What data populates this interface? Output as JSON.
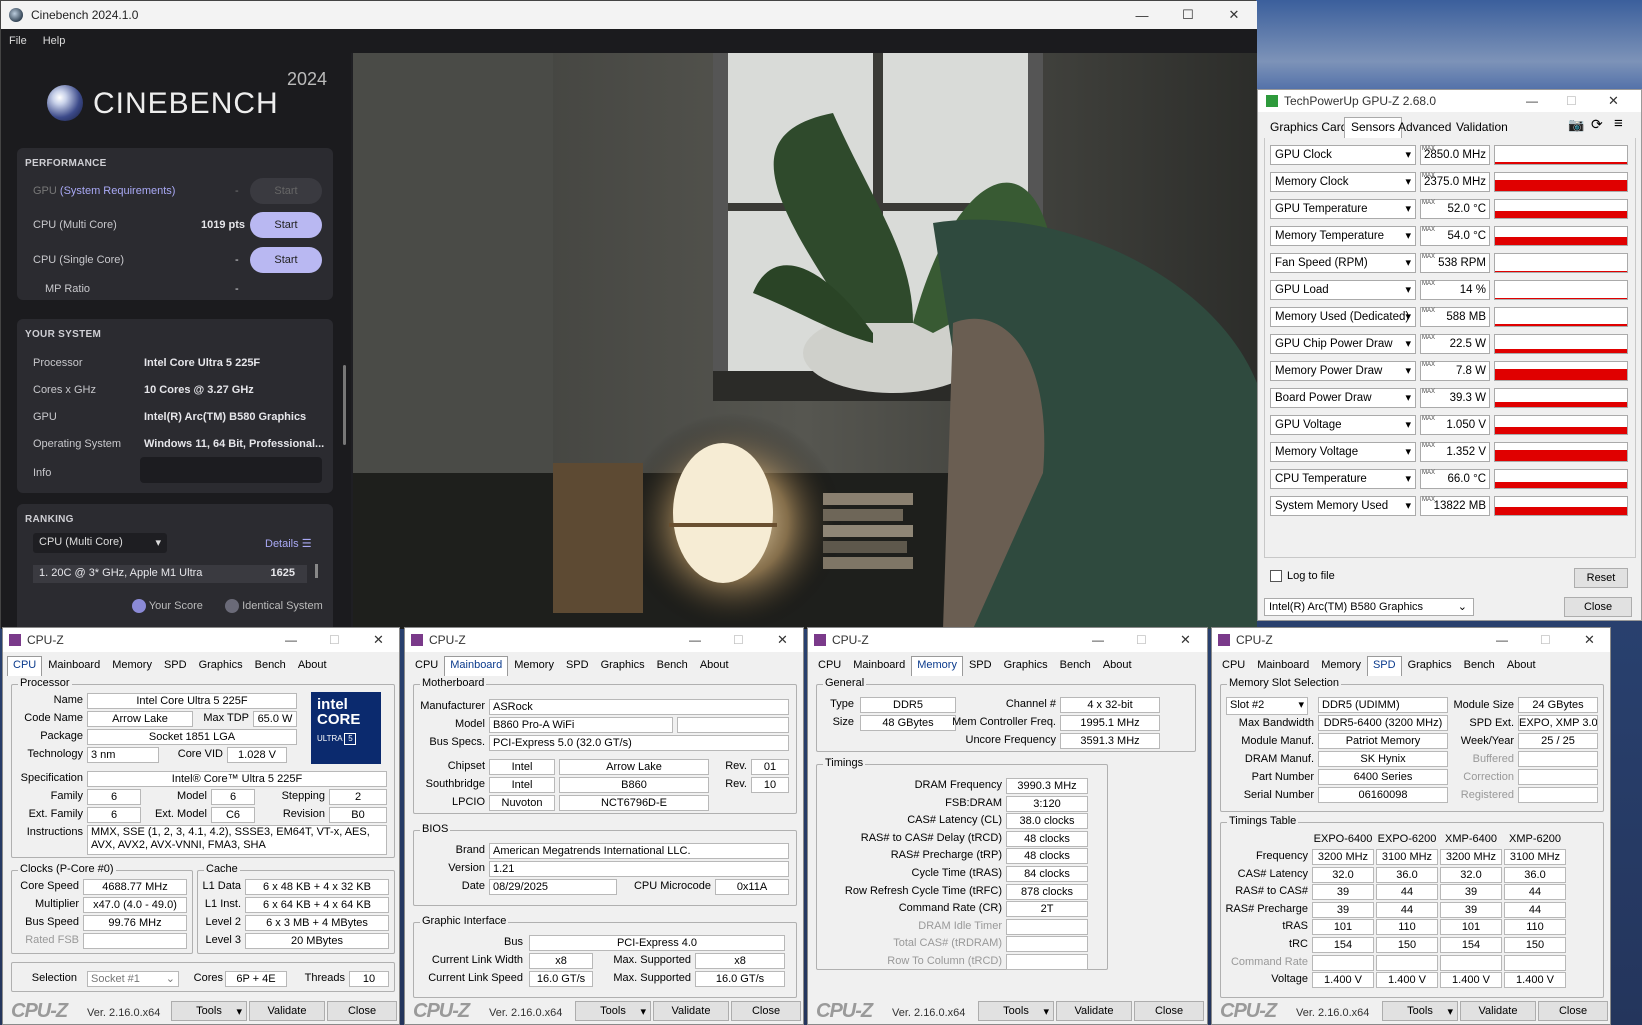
{
  "cinebench": {
    "title": "Cinebench 2024.1.0",
    "menu": [
      "File",
      "Help"
    ],
    "logo": "CINEBENCH",
    "logo_year": "2024",
    "performance": {
      "header": "PERFORMANCE",
      "gpu_label": "GPU",
      "gpu_link": "(System Requirements)",
      "gpu_value": "-",
      "multi_label": "CPU (Multi Core)",
      "multi_value": "1019 pts",
      "single_label": "CPU (Single Core)",
      "single_value": "-",
      "mp_label": "MP Ratio",
      "mp_value": "-",
      "start": "Start"
    },
    "system": {
      "header": "YOUR SYSTEM",
      "rows": [
        {
          "label": "Processor",
          "value": "Intel Core Ultra 5 225F"
        },
        {
          "label": "Cores x GHz",
          "value": "10 Cores @ 3.27 GHz"
        },
        {
          "label": "GPU",
          "value": "Intel(R) Arc(TM) B580 Graphics"
        },
        {
          "label": "Operating System",
          "value": "Windows 11, 64 Bit, Professional..."
        }
      ],
      "info_label": "Info"
    },
    "ranking": {
      "header": "RANKING",
      "dropdown": "CPU (Multi Core)",
      "details": "Details",
      "entry": "1. 20C @ 3* GHz, Apple M1 Ultra",
      "entry_score": "1625",
      "legend_your": "Your Score",
      "legend_identical": "Identical System"
    }
  },
  "gpuz": {
    "title": "TechPowerUp GPU-Z 2.68.0",
    "tabs": [
      "Graphics Card",
      "Sensors",
      "Advanced",
      "Validation"
    ],
    "max_tag": "MAX",
    "sensors": [
      {
        "name": "GPU Clock",
        "value": "2850.0 MHz",
        "level": 0.1
      },
      {
        "name": "Memory Clock",
        "value": "2375.0 MHz",
        "level": 0.6
      },
      {
        "name": "GPU Temperature",
        "value": "52.0 °C",
        "level": 0.4
      },
      {
        "name": "Memory Temperature",
        "value": "54.0 °C",
        "level": 0.45
      },
      {
        "name": "Fan Speed (RPM)",
        "value": "538 RPM",
        "level": 0.05
      },
      {
        "name": "GPU Load",
        "value": "14 %",
        "level": 0.05
      },
      {
        "name": "Memory Used (Dedicated)",
        "value": "588 MB",
        "level": 0.1
      },
      {
        "name": "GPU Chip Power Draw",
        "value": "22.5 W",
        "level": 0.2
      },
      {
        "name": "Memory Power Draw",
        "value": "7.8 W",
        "level": 0.6
      },
      {
        "name": "Board Power Draw",
        "value": "39.3 W",
        "level": 0.25
      },
      {
        "name": "GPU Voltage",
        "value": "1.050 V",
        "level": 0.4
      },
      {
        "name": "Memory Voltage",
        "value": "1.352 V",
        "level": 0.6
      },
      {
        "name": "CPU Temperature",
        "value": "66.0 °C",
        "level": 0.35
      },
      {
        "name": "System Memory Used",
        "value": "13822 MB",
        "level": 0.45
      }
    ],
    "log_label": "Log to file",
    "reset": "Reset",
    "device": "Intel(R) Arc(TM) B580 Graphics",
    "close": "Close"
  },
  "cpuz_common": {
    "title": "CPU-Z",
    "tabs": [
      "CPU",
      "Mainboard",
      "Memory",
      "SPD",
      "Graphics",
      "Bench",
      "About"
    ],
    "logo": "CPU-Z",
    "version": "Ver. 2.16.0.x64",
    "tools": "Tools",
    "validate": "Validate",
    "close": "Close"
  },
  "cpuz_cpu": {
    "processor_label": "Processor",
    "name_l": "Name",
    "name": "Intel Core Ultra 5 225F",
    "codename_l": "Code Name",
    "codename": "Arrow Lake",
    "maxtdp_l": "Max TDP",
    "maxtdp": "65.0 W",
    "package_l": "Package",
    "package": "Socket 1851 LGA",
    "tech_l": "Technology",
    "tech": "3 nm",
    "vid_l": "Core VID",
    "vid": "1.028 V",
    "spec_l": "Specification",
    "spec": "Intel® Core™ Ultra 5 225F",
    "family_l": "Family",
    "family": "6",
    "model_l": "Model",
    "model": "6",
    "stepping_l": "Stepping",
    "stepping": "2",
    "extfamily_l": "Ext. Family",
    "extfamily": "6",
    "extmodel_l": "Ext. Model",
    "extmodel": "C6",
    "revision_l": "Revision",
    "revision": "B0",
    "instr_l": "Instructions",
    "instr": "MMX, SSE (1, 2, 3, 4.1, 4.2), SSSE3, EM64T, VT-x, AES, AVX, AVX2, AVX-VNNI, FMA3, SHA",
    "clocks_label": "Clocks (P-Core #0)",
    "corespeed_l": "Core Speed",
    "corespeed": "4688.77 MHz",
    "mult_l": "Multiplier",
    "mult": "x47.0 (4.0 - 49.0)",
    "bus_l": "Bus Speed",
    "bus": "99.76 MHz",
    "fsb_l": "Rated FSB",
    "cache_label": "Cache",
    "l1d_l": "L1 Data",
    "l1d": "6 x 48 KB + 4 x 32 KB",
    "l1i_l": "L1 Inst.",
    "l1i": "6 x 64 KB + 4 x 64 KB",
    "l2_l": "Level 2",
    "l2": "6 x 3 MB + 4 MBytes",
    "l3_l": "Level 3",
    "l3": "20 MBytes",
    "sel_l": "Selection",
    "sel": "Socket #1",
    "cores_l": "Cores",
    "cores": "6P + 4E",
    "threads_l": "Threads",
    "threads": "10",
    "badge_line1": "intel",
    "badge_line2": "CORE",
    "badge_line3": "ULTRA",
    "badge_num": "5"
  },
  "cpuz_mb": {
    "mb_label": "Motherboard",
    "manuf_l": "Manufacturer",
    "manuf": "ASRock",
    "model_l": "Model",
    "model": "B860 Pro-A WiFi",
    "busspec_l": "Bus Specs.",
    "busspec": "PCI-Express 5.0 (32.0 GT/s)",
    "chipset_l": "Chipset",
    "chipset1": "Intel",
    "chipset2": "Arrow Lake",
    "rev_l": "Rev.",
    "chipset_rev": "01",
    "south_l": "Southbridge",
    "south1": "Intel",
    "south2": "B860",
    "south_rev": "10",
    "lpcio_l": "LPCIO",
    "lpcio1": "Nuvoton",
    "lpcio2": "NCT6796D-E",
    "bios_label": "BIOS",
    "brand_l": "Brand",
    "brand": "American Megatrends International LLC.",
    "version_l": "Version",
    "version": "1.21",
    "date_l": "Date",
    "date": "08/29/2025",
    "micro_l": "CPU Microcode",
    "micro": "0x11A",
    "gi_label": "Graphic Interface",
    "gbus_l": "Bus",
    "gbus": "PCI-Express 4.0",
    "clw_l": "Current Link Width",
    "clw": "x8",
    "msw_l": "Max. Supported",
    "msw": "x8",
    "cls_l": "Current Link Speed",
    "cls": "16.0 GT/s",
    "mss_l": "Max. Supported",
    "mss": "16.0 GT/s"
  },
  "cpuz_mem": {
    "general_label": "General",
    "type_l": "Type",
    "type": "DDR5",
    "size_l": "Size",
    "size": "48 GBytes",
    "channel_l": "Channel #",
    "channel": "4 x 32-bit",
    "mcf_l": "Mem Controller Freq.",
    "mcf": "1995.1 MHz",
    "uncore_l": "Uncore Frequency",
    "uncore": "3591.3 MHz",
    "timings_label": "Timings",
    "rows": [
      {
        "label": "DRAM Frequency",
        "value": "3990.3 MHz"
      },
      {
        "label": "FSB:DRAM",
        "value": "3:120"
      },
      {
        "label": "CAS# Latency (CL)",
        "value": "38.0 clocks"
      },
      {
        "label": "RAS# to CAS# Delay (tRCD)",
        "value": "48 clocks"
      },
      {
        "label": "RAS# Precharge (tRP)",
        "value": "48 clocks"
      },
      {
        "label": "Cycle Time (tRAS)",
        "value": "84 clocks"
      },
      {
        "label": "Row Refresh Cycle Time (tRFC)",
        "value": "878 clocks"
      },
      {
        "label": "Command Rate (CR)",
        "value": "2T"
      },
      {
        "label": "DRAM Idle Timer",
        "value": ""
      },
      {
        "label": "Total CAS# (tRDRAM)",
        "value": ""
      },
      {
        "label": "Row To Column (tRCD)",
        "value": ""
      }
    ]
  },
  "cpuz_spd": {
    "slot_label": "Memory Slot Selection",
    "slot": "Slot #2",
    "slot_type": "DDR5 (UDIMM)",
    "modsize_l": "Module Size",
    "modsize": "24 GBytes",
    "maxbw_l": "Max Bandwidth",
    "maxbw": "DDR5-6400 (3200 MHz)",
    "spdext_l": "SPD Ext.",
    "spdext": "EXPO, XMP 3.0",
    "modman_l": "Module Manuf.",
    "modman": "Patriot Memory",
    "week_l": "Week/Year",
    "week": "25 / 25",
    "dram_l": "DRAM Manuf.",
    "dram": "SK Hynix",
    "buffered_l": "Buffered",
    "part_l": "Part Number",
    "part": "6400 Series",
    "correction_l": "Correction",
    "serial_l": "Serial Number",
    "serial": "06160098",
    "registered_l": "Registered",
    "tt_label": "Timings Table",
    "cols": [
      "EXPO-6400",
      "EXPO-6200",
      "XMP-6400",
      "XMP-6200"
    ],
    "rows": [
      {
        "label": "Frequency",
        "values": [
          "3200 MHz",
          "3100 MHz",
          "3200 MHz",
          "3100 MHz"
        ]
      },
      {
        "label": "CAS# Latency",
        "values": [
          "32.0",
          "36.0",
          "32.0",
          "36.0"
        ]
      },
      {
        "label": "RAS# to CAS#",
        "values": [
          "39",
          "44",
          "39",
          "44"
        ]
      },
      {
        "label": "RAS# Precharge",
        "values": [
          "39",
          "44",
          "39",
          "44"
        ]
      },
      {
        "label": "tRAS",
        "values": [
          "101",
          "110",
          "101",
          "110"
        ]
      },
      {
        "label": "tRC",
        "values": [
          "154",
          "150",
          "154",
          "150"
        ]
      },
      {
        "label": "Command Rate",
        "values": [
          "",
          "",
          "",
          ""
        ]
      },
      {
        "label": "Voltage",
        "values": [
          "1.400 V",
          "1.400 V",
          "1.400 V",
          "1.400 V"
        ]
      }
    ]
  }
}
